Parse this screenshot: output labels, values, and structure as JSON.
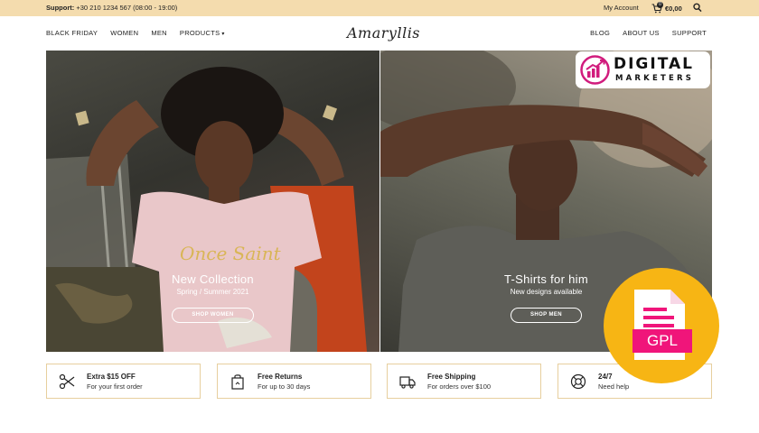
{
  "topbar": {
    "support_label": "Support:",
    "support_text": "+30 210 1234 567 (08:00 - 19:00)",
    "account": "My Account",
    "cart_count": "0",
    "cart_total": "€0,00"
  },
  "nav": {
    "left": [
      "BLACK FRIDAY",
      "WOMEN",
      "MEN",
      "PRODUCTS"
    ],
    "logo": "Amaryllis",
    "right": [
      "BLOG",
      "ABOUT US",
      "SUPPORT"
    ]
  },
  "hero": {
    "left": {
      "title": "New Collection",
      "subtitle": "Spring / Summer 2021",
      "button": "SHOP WOMEN"
    },
    "right": {
      "title": "T-Shirts for him",
      "subtitle": "New designs available",
      "button": "SHOP MEN"
    }
  },
  "features": [
    {
      "icon": "scissors-icon",
      "title": "Extra $15 OFF",
      "subtitle": "For your first order"
    },
    {
      "icon": "bag-return-icon",
      "title": "Free Returns",
      "subtitle": "For up to 30 days"
    },
    {
      "icon": "truck-icon",
      "title": "Free Shipping",
      "subtitle": "For orders over $100"
    },
    {
      "icon": "lifebuoy-icon",
      "title": "24/7",
      "subtitle": "Need help"
    }
  ],
  "watermark": {
    "line1": "DIGITAL",
    "line2": "MARKETERS"
  },
  "badge": {
    "label": "GPL"
  },
  "colors": {
    "topbar": "#f4dcae",
    "feature_border": "#e7cf9e",
    "gpl_circle": "#f7b514",
    "gpl_label": "#f0157a",
    "dm_magenta": "#d11c7d"
  }
}
